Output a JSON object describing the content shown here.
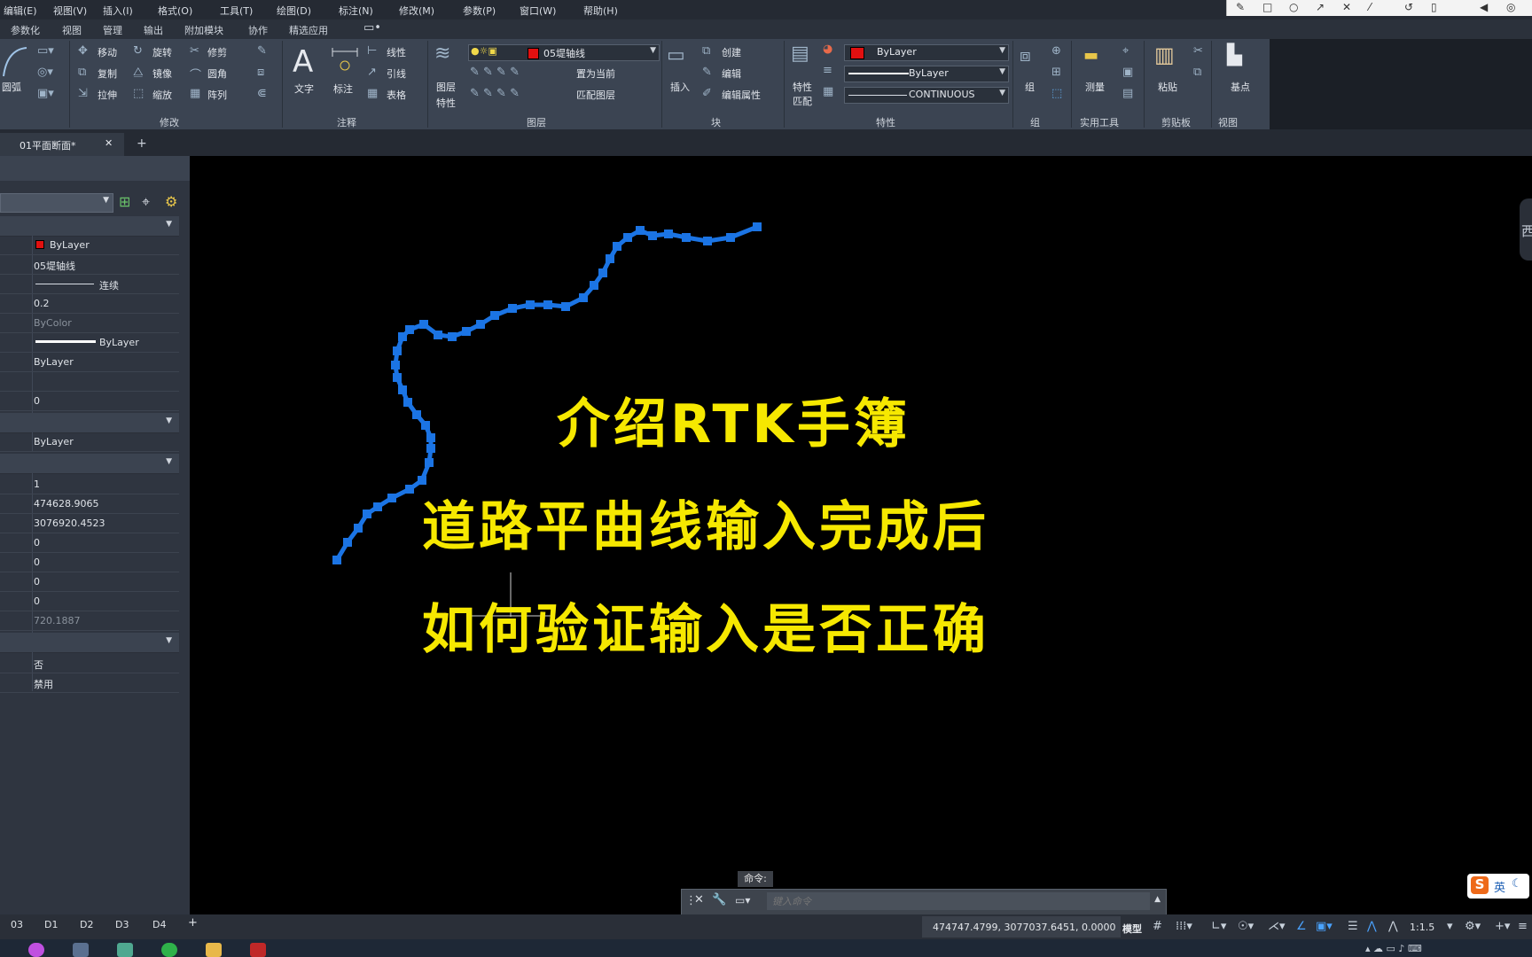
{
  "menubar": [
    "编辑(E)",
    "视图(V)",
    "插入(I)",
    "格式(O)",
    "工具(T)",
    "绘图(D)",
    "标注(N)",
    "修改(M)",
    "参数(P)",
    "窗口(W)",
    "帮助(H)"
  ],
  "ribbon_tabs": [
    "参数化",
    "视图",
    "管理",
    "输出",
    "附加模块",
    "协作",
    "精选应用"
  ],
  "ribbon": {
    "draw": {
      "arc": "圆弧"
    },
    "modify": {
      "move": "移动",
      "rotate": "旋转",
      "trim": "修剪",
      "copy": "复制",
      "mirror": "镜像",
      "fillet": "圆角",
      "stretch": "拉伸",
      "scale": "缩放",
      "array": "阵列",
      "label": "修改"
    },
    "annotation": {
      "text": "文字",
      "dimension": "标注",
      "linear": "线性",
      "leader": "引线",
      "table": "表格",
      "label": "注释"
    },
    "layers": {
      "properties_line1": "图层",
      "properties_line2": "特性",
      "current_layer": "05堤轴线",
      "set_current": "置为当前",
      "match_layer": "匹配图层",
      "label": "图层"
    },
    "block": {
      "insert": "插入",
      "create": "创建",
      "edit": "编辑",
      "edit_attributes": "编辑属性",
      "label": "块"
    },
    "properties": {
      "match_line1": "特性",
      "match_line2": "匹配",
      "color": "ByLayer",
      "lineweight": "ByLayer",
      "linetype": "CONTINUOUS",
      "label": "特性"
    },
    "groups": {
      "group": "组",
      "label": "组"
    },
    "utilities": {
      "measure": "测量",
      "label": "实用工具"
    },
    "clipboard": {
      "paste": "粘贴",
      "label": "剪贴板"
    },
    "view": {
      "base": "基点",
      "label": "视图"
    }
  },
  "doc_tab": {
    "name": "01平面断面*",
    "close": "✕",
    "add": "+"
  },
  "palette": {
    "general": [
      "ByLayer",
      "05堤轴线",
      "连续",
      "0.2",
      "ByColor",
      "ByLayer",
      "ByLayer",
      "",
      "0"
    ],
    "section2": [
      "ByLayer"
    ],
    "geometry": [
      "1",
      "474628.9065",
      "3076920.4523",
      "0",
      "0",
      "0",
      "0",
      "720.1887"
    ],
    "misc": [
      "否",
      "禁用"
    ]
  },
  "overlay": {
    "line1": "介绍RTK手簿",
    "line2": "道路平曲线输入完成后",
    "line3": "如何验证输入是否正确"
  },
  "viewcube_letter": "西",
  "command": {
    "label": "命令:",
    "placeholder": "键入命令"
  },
  "layout_tabs": [
    "03",
    "D1",
    "D2",
    "D3",
    "D4",
    "+"
  ],
  "status": {
    "coords": "474747.4799, 3077037.6451, 0.0000",
    "model": "模型",
    "scale": "1:1.5"
  },
  "ime": {
    "label": "英"
  },
  "colors": {
    "accent_blue": "#1b74e4",
    "overlay_yellow": "#f6e800",
    "layer_red": "#e01010"
  }
}
